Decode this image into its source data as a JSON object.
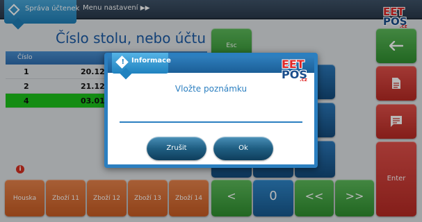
{
  "topbar": {
    "active_tab_label": "Správa účtenek",
    "menu_settings_label": "Menu nastavení",
    "menu_settings_arrow": "▶▶",
    "tab_icon": "diamond-icon"
  },
  "logo": {
    "line1": "EET",
    "line2": "POS",
    "line3": ".cz"
  },
  "page_title": "Číslo stolu, nebo účtu",
  "table": {
    "headers": [
      "Číslo",
      ""
    ],
    "rows": [
      {
        "num": "1",
        "date": "20.12."
      },
      {
        "num": "2",
        "date": "21.12."
      },
      {
        "num": "4",
        "date": "03.01."
      }
    ],
    "selected_index": 2
  },
  "buttons": {
    "esc": "Esc",
    "back_icon": "arrow-left-icon",
    "document_icon": "document-icon",
    "comment_icon": "comment-icon",
    "enter": "Enter",
    "products": [
      "Houska",
      "Zboží 11",
      "Zboží 12",
      "Zboží 13",
      "Zboží 14"
    ],
    "nav": [
      "<",
      "0",
      "<<",
      ">>"
    ]
  },
  "dialog": {
    "title": "Informace",
    "message": "Vložte poznámku",
    "input_value": "",
    "cancel_label": "Zrušit",
    "ok_label": "Ok"
  },
  "colors": {
    "accent": "#2b7fc0",
    "selected_row": "#1dc21b",
    "orange": "#d8692f",
    "green": "#3a9e38",
    "red": "#c9352f",
    "blue": "#1f6cab"
  }
}
